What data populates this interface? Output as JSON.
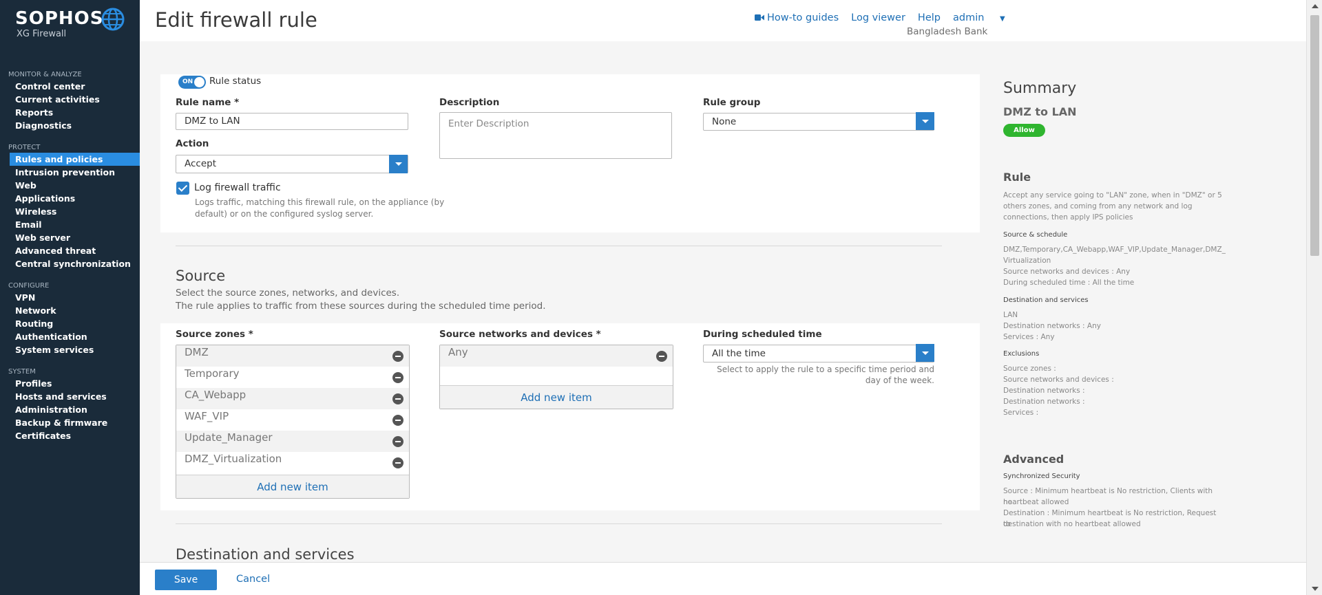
{
  "brand": {
    "logo": "SOPHOS",
    "product": "XG Firewall"
  },
  "header": {
    "title": "Edit firewall rule",
    "links": {
      "howto": "How-to guides",
      "log_viewer": "Log viewer",
      "help": "Help",
      "admin": "admin"
    },
    "org": "Bangladesh Bank"
  },
  "sidebar": {
    "monitor_title": "MONITOR & ANALYZE",
    "monitor": [
      "Control center",
      "Current activities",
      "Reports",
      "Diagnostics"
    ],
    "protect_title": "PROTECT",
    "protect": [
      "Rules and policies",
      "Intrusion prevention",
      "Web",
      "Applications",
      "Wireless",
      "Email",
      "Web server",
      "Advanced threat",
      "Central synchronization"
    ],
    "configure_title": "CONFIGURE",
    "configure": [
      "VPN",
      "Network",
      "Routing",
      "Authentication",
      "System services"
    ],
    "system_title": "SYSTEM",
    "system": [
      "Profiles",
      "Hosts and services",
      "Administration",
      "Backup & firmware",
      "Certificates"
    ]
  },
  "form": {
    "toggle_on": "ON",
    "rule_status": "Rule status",
    "rule_name_label": "Rule name *",
    "rule_name_value": "DMZ to LAN",
    "description_label": "Description",
    "description_placeholder": "Enter Description",
    "rule_group_label": "Rule group",
    "rule_group_value": "None",
    "action_label": "Action",
    "action_value": "Accept",
    "log_label": "Log firewall traffic",
    "log_hint_1": "Logs traffic, matching this firewall rule, on the appliance (by",
    "log_hint_2": "default) or on the configured syslog server."
  },
  "source": {
    "title": "Source",
    "desc1": "Select the source zones, networks, and devices.",
    "desc2": "The rule applies to traffic from these sources during the scheduled time period.",
    "zones_label": "Source zones *",
    "zones": [
      "DMZ",
      "Temporary",
      "CA_Webapp",
      "WAF_VIP",
      "Update_Manager",
      "DMZ_Virtualization"
    ],
    "add_new": "Add new item",
    "networks_label": "Source networks and devices *",
    "networks": [
      "Any"
    ],
    "schedule_label": "During scheduled time",
    "schedule_value": "All the time",
    "schedule_hint_1": "Select to apply the rule to a specific time period and",
    "schedule_hint_2": "day of the week."
  },
  "destination": {
    "title": "Destination and services"
  },
  "summary": {
    "title": "Summary",
    "rule_name": "DMZ to LAN",
    "badge": "Allow",
    "rule_heading": "Rule",
    "rule_text_1": "Accept any service going to \"LAN\" zone, when in \"DMZ\" or 5",
    "rule_text_2": "others zones, and coming from any network and log",
    "rule_text_3": "connections, then apply IPS policies",
    "src_sched_h": "Source & schedule",
    "src_1": "DMZ,Temporary,CA_Webapp,WAF_VIP,Update_Manager,DMZ_",
    "src_2": "Virtualization",
    "src_3": "Source networks and devices : Any",
    "src_4": "During scheduled time : All the time",
    "dest_h": "Destination and services",
    "dest_1": "LAN",
    "dest_2": "Destination networks : Any",
    "dest_3": "Services : Any",
    "excl_h": "Exclusions",
    "excl_1": "Source zones :",
    "excl_2": "Source networks and devices :",
    "excl_3": "Destination networks :",
    "excl_4": "Destination networks :",
    "excl_5": "Services :",
    "adv_heading": "Advanced",
    "sync_h": "Synchronized Security",
    "sync_1": "Source : Minimum heartbeat is No restriction, Clients with no",
    "sync_2": "heartbeat allowed",
    "sync_3": "Destination : Minimum heartbeat is No restriction, Request to",
    "sync_4": "destination with no heartbeat allowed"
  },
  "footer": {
    "save": "Save",
    "cancel": "Cancel"
  },
  "colors": {
    "sidebar": "#1a2b3a",
    "accent": "#2a7fc9",
    "link": "#1e6fb5",
    "allow": "#2fb52f"
  }
}
